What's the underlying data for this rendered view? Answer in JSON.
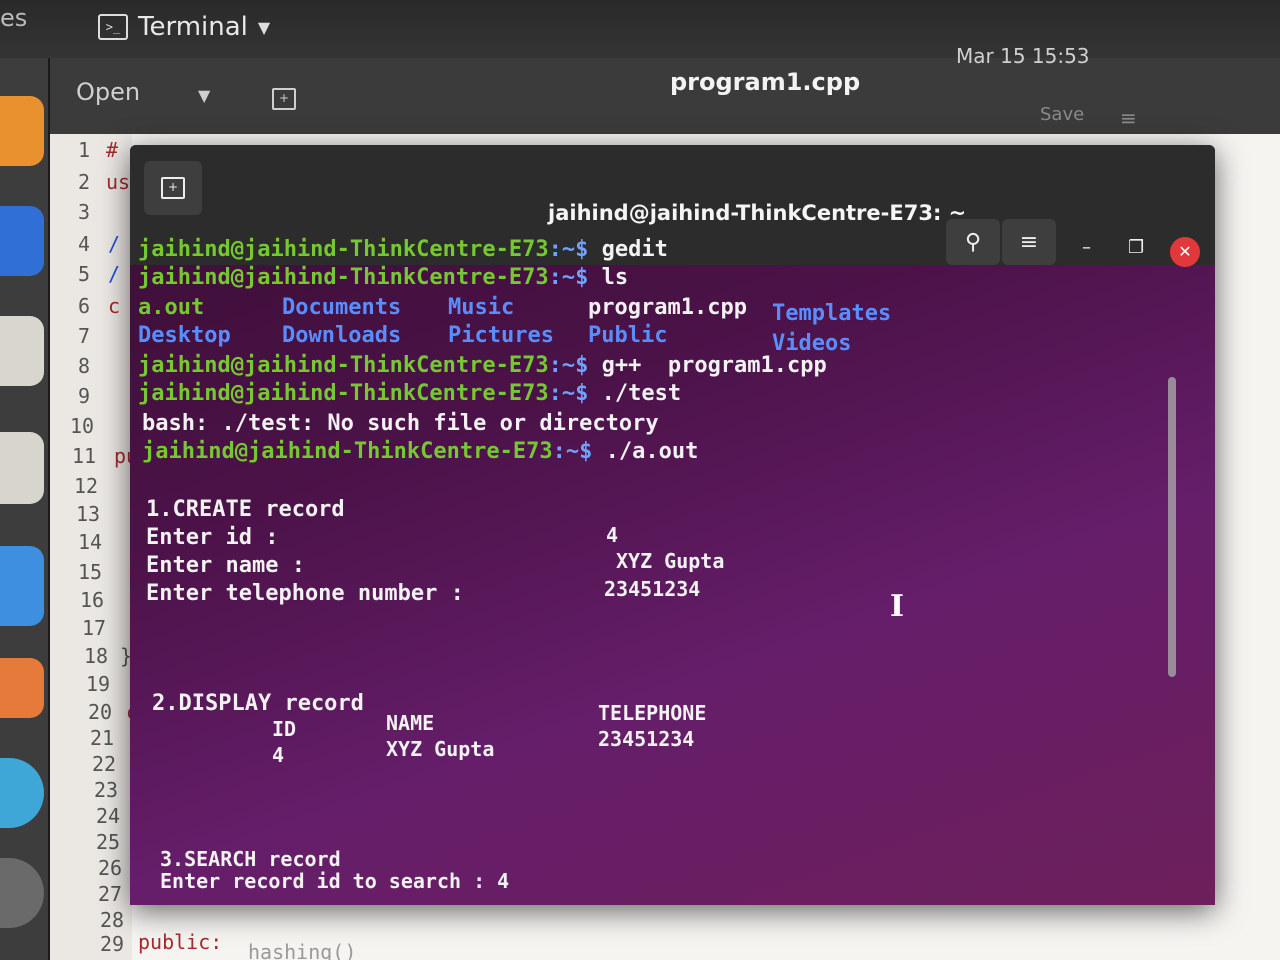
{
  "topbar": {
    "activities_label": "es",
    "app_menu_label": "Terminal",
    "clock": "Mar 15 15:53"
  },
  "gedit": {
    "open_label": "Open",
    "file_title": "program1.cpp",
    "save_label": "Save",
    "line_numbers": [
      "1",
      "2",
      "3",
      "4",
      "5",
      "6",
      "7",
      "8",
      "9",
      "10",
      "11",
      "12",
      "13",
      "14",
      "15",
      "16",
      "17",
      "18",
      "19",
      "20",
      "21",
      "22",
      "23",
      "24",
      "25",
      "26",
      "27",
      "28",
      "29"
    ],
    "visible_code": {
      "l1": "#",
      "l2": "us",
      "l4": "/",
      "l5": "/",
      "l6": "c",
      "l11": "pu",
      "l18": "};",
      "l20": "c",
      "l29": "public:",
      "l29b": "hashing()"
    }
  },
  "terminal": {
    "title": "jaihind@jaihind-ThinkCentre-E73: ~",
    "prompt": "jaihind@jaihind-ThinkCentre-E73",
    "path": ":~$",
    "lines": {
      "cmd_gedit": " gedit",
      "cmd_ls": " ls",
      "ls_aout": "a.out",
      "ls_documents": "Documents",
      "ls_music": "Music",
      "ls_program": "program1.cpp",
      "ls_templates": "Templates",
      "ls_desktop": "Desktop",
      "ls_downloads": "Downloads",
      "ls_pictures": "Pictures",
      "ls_public": "Public",
      "ls_videos": "Videos",
      "cmd_gpp": " g++  program1.cpp",
      "cmd_test": " ./test",
      "err_test": "bash: ./test: No such file or directory",
      "cmd_aout": " ./a.out",
      "create_header": "1.CREATE record",
      "enter_id": "Enter id :",
      "id_value": "4",
      "enter_name": "Enter name :",
      "name_value": "XYZ Gupta",
      "enter_phone": "Enter telephone number :",
      "phone_value": "23451234",
      "display_header": "2.DISPLAY record",
      "col_id": "ID",
      "col_name": "NAME",
      "col_phone": "TELEPHONE",
      "row_id": "4",
      "row_name": "XYZ Gupta",
      "row_phone": "23451234",
      "search_header": "3.SEARCH record",
      "search_prompt": "Enter record id to search : 4"
    }
  },
  "icons": {
    "terminal": "terminal-icon",
    "new_tab": "new-tab-icon",
    "search": "search-icon",
    "menu": "hamburger-menu-icon",
    "minimize": "minimize-icon",
    "maximize": "maximize-icon",
    "close": "close-icon",
    "text_cursor": "i-beam-cursor-icon"
  },
  "colors": {
    "terminal_bg": "#4b1248",
    "prompt_green": "#76c832",
    "path_blue": "#6fa3ff",
    "close_red": "#e0383b"
  }
}
